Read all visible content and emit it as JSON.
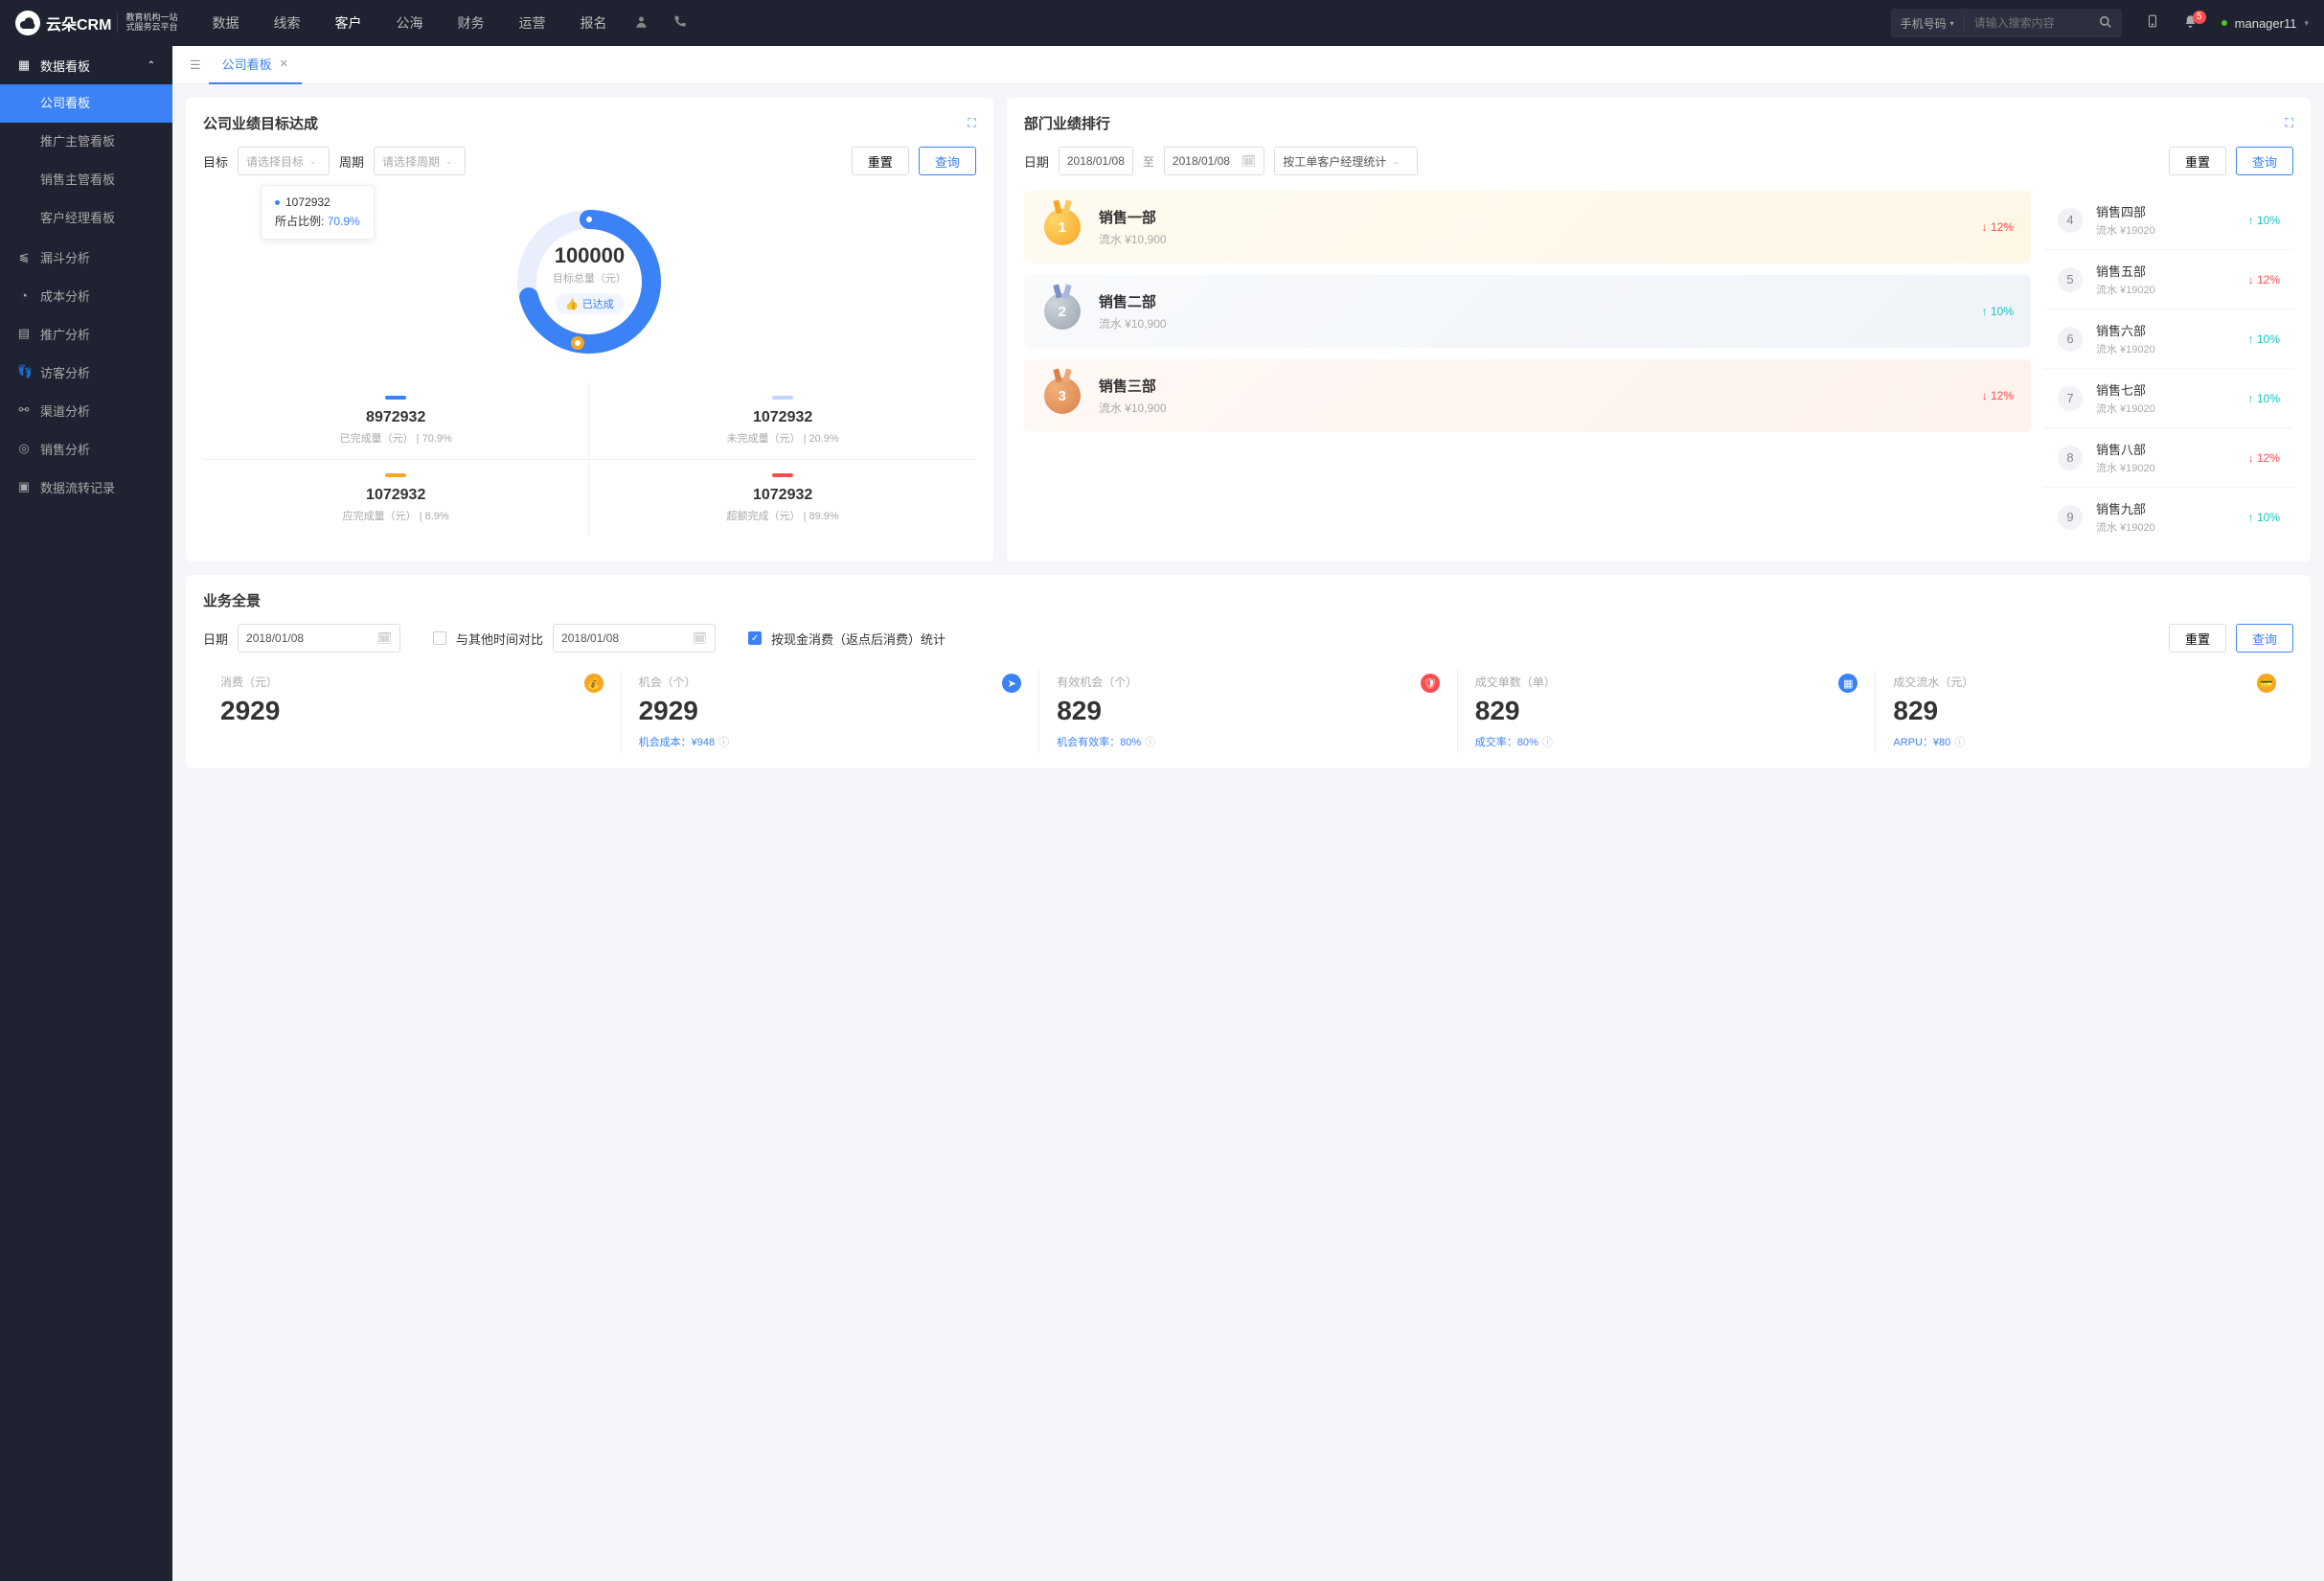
{
  "header": {
    "brand": "云朵CRM",
    "brand_sub": "教育机构一站\n式服务云平台",
    "nav": [
      "数据",
      "线索",
      "客户",
      "公海",
      "财务",
      "运营",
      "报名"
    ],
    "nav_active": 2,
    "search_type": "手机号码",
    "search_ph": "请输入搜索内容",
    "notif_count": "5",
    "user": "manager11"
  },
  "sidebar": {
    "group": "数据看板",
    "items": [
      "公司看板",
      "推广主管看板",
      "销售主管看板",
      "客户经理看板"
    ],
    "active": 0,
    "others": [
      "漏斗分析",
      "成本分析",
      "推广分析",
      "访客分析",
      "渠道分析",
      "销售分析",
      "数据流转记录"
    ]
  },
  "tabs": {
    "current": "公司看板"
  },
  "goal": {
    "title": "公司业绩目标达成",
    "lbl_target": "目标",
    "ph_target": "请选择目标",
    "lbl_period": "周期",
    "ph_period": "请选择周期",
    "btn_reset": "重置",
    "btn_query": "查询",
    "tip_val": "1072932",
    "tip_lbl": "所占比例:",
    "tip_pct": "70.9%",
    "center_val": "100000",
    "center_lbl": "目标总量（元）",
    "center_badge": "已达成",
    "stats": [
      {
        "bar": "#3b82f6",
        "v": "8972932",
        "l": "已完成量（元） | 70.9%"
      },
      {
        "bar": "#bdd6ff",
        "v": "1072932",
        "l": "未完成量（元） | 20.9%"
      },
      {
        "bar": "#f5a623",
        "v": "1072932",
        "l": "应完成量（元） | 8.9%"
      },
      {
        "bar": "#ff4d4f",
        "v": "1072932",
        "l": "超额完成（元） | 89.9%"
      }
    ]
  },
  "rank": {
    "title": "部门业绩排行",
    "lbl_date": "日期",
    "d1": "2018/01/08",
    "to": "至",
    "d2": "2018/01/08",
    "sel": "按工单客户经理统计",
    "btn_reset": "重置",
    "btn_query": "查询",
    "top": [
      {
        "n": "1",
        "cls": "g",
        "name": "销售一部",
        "sub": "流水 ¥10,900",
        "trend": "down",
        "pct": "12%"
      },
      {
        "n": "2",
        "cls": "s",
        "name": "销售二部",
        "sub": "流水 ¥10,900",
        "trend": "up",
        "pct": "10%"
      },
      {
        "n": "3",
        "cls": "b",
        "name": "销售三部",
        "sub": "流水 ¥10,900",
        "trend": "down",
        "pct": "12%"
      }
    ],
    "rest": [
      {
        "n": "4",
        "name": "销售四部",
        "sub": "流水 ¥19020",
        "trend": "up",
        "pct": "10%"
      },
      {
        "n": "5",
        "name": "销售五部",
        "sub": "流水 ¥19020",
        "trend": "down",
        "pct": "12%"
      },
      {
        "n": "6",
        "name": "销售六部",
        "sub": "流水 ¥19020",
        "trend": "up",
        "pct": "10%"
      },
      {
        "n": "7",
        "name": "销售七部",
        "sub": "流水 ¥19020",
        "trend": "up",
        "pct": "10%"
      },
      {
        "n": "8",
        "name": "销售八部",
        "sub": "流水 ¥19020",
        "trend": "down",
        "pct": "12%"
      },
      {
        "n": "9",
        "name": "销售九部",
        "sub": "流水 ¥19020",
        "trend": "up",
        "pct": "10%"
      }
    ]
  },
  "pano": {
    "title": "业务全景",
    "lbl_date": "日期",
    "d1": "2018/01/08",
    "chk1_lbl": "与其他时间对比",
    "d2": "2018/01/08",
    "chk2_lbl": "按现金消费（返点后消费）统计",
    "btn_reset": "重置",
    "btn_query": "查询",
    "metrics": [
      {
        "lbl": "消费（元）",
        "ic": "#f5a623",
        "val": "2929",
        "sub": ""
      },
      {
        "lbl": "机会（个）",
        "ic": "#3b82f6",
        "val": "2929",
        "sub": "机会成本：¥948"
      },
      {
        "lbl": "有效机会（个）",
        "ic": "#ff4d4f",
        "val": "829",
        "sub": "机会有效率：80%"
      },
      {
        "lbl": "成交单数（单）",
        "ic": "#3b82f6",
        "val": "829",
        "sub": "成交率：80%"
      },
      {
        "lbl": "成交流水（元）",
        "ic": "#f5a623",
        "val": "829",
        "sub": "ARPU：¥80"
      }
    ]
  },
  "chart_data": {
    "type": "pie",
    "title": "目标达成",
    "total": 100000,
    "series": [
      {
        "name": "已完成量",
        "value": 8972932,
        "pct": 70.9,
        "color": "#3b82f6"
      },
      {
        "name": "未完成量",
        "value": 1072932,
        "pct": 20.9,
        "color": "#bdd6ff"
      },
      {
        "name": "应完成量",
        "value": 1072932,
        "pct": 8.9,
        "color": "#f5a623"
      },
      {
        "name": "超额完成",
        "value": 1072932,
        "pct": 89.9,
        "color": "#ff4d4f"
      }
    ]
  }
}
